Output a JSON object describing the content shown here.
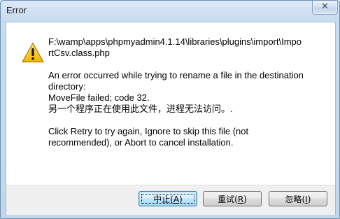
{
  "window": {
    "title": "Error",
    "close_glyph": "✕"
  },
  "icon": "warning-icon",
  "message": {
    "path_line1": "F:\\wamp\\apps\\phpmyadmin4.1.14\\libraries\\plugins\\import\\Impo",
    "path_line2": "rtCsv.class.php",
    "error_line1": "An error occurred while trying to rename a file in the destination",
    "error_line2": "directory:",
    "error_line3": "MoveFile failed; code 32.",
    "error_line4": "另一个程序正在使用此文件，进程无法访问。.",
    "instr_line1": "Click Retry to try again, Ignore to skip this file (not",
    "instr_line2": "recommended), or Abort to cancel installation."
  },
  "buttons": {
    "abort": {
      "pre": "中止(",
      "key": "A",
      "post": ")"
    },
    "retry": {
      "pre": "重试(",
      "key": "R",
      "post": ")"
    },
    "ignore": {
      "pre": "忽略(",
      "key": "I",
      "post": ")"
    }
  },
  "colors": {
    "accent": "#3c7fb1",
    "warning": "#f5c400"
  }
}
